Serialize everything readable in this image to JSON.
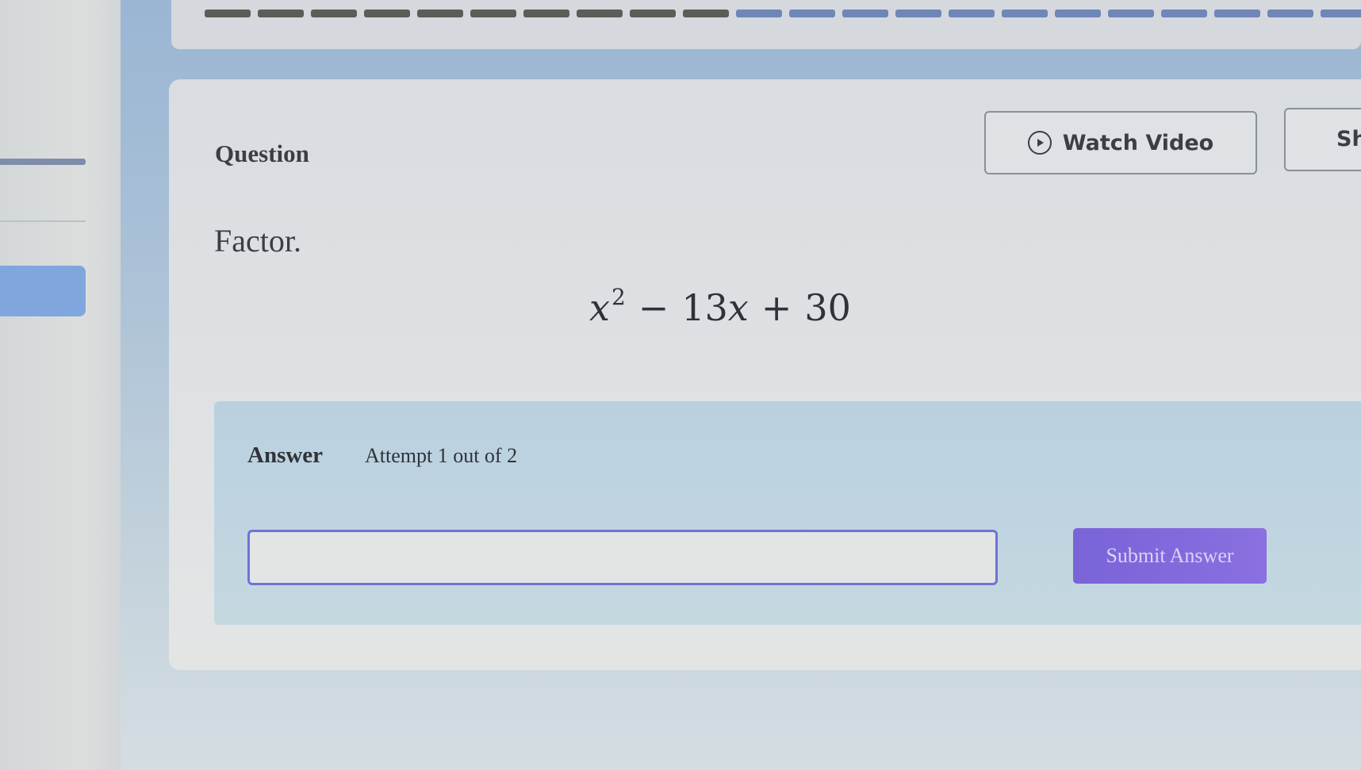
{
  "progress": {
    "segments_total": 22,
    "segments_done": 10
  },
  "question": {
    "label": "Question",
    "watch_video_label": "Watch Video",
    "show_example_label": "Sh",
    "instruction": "Factor.",
    "expression": {
      "var": "x",
      "exponent": "2",
      "op1": "−",
      "term2_coef": "13",
      "term2_var": "x",
      "op2": "+",
      "constant": "30"
    }
  },
  "answer": {
    "label": "Answer",
    "attempt_text": "Attempt 1 out of 2",
    "input_value": "",
    "submit_label": "Submit Answer"
  },
  "colors": {
    "accent": "#7a63d8",
    "input_border": "#6d73d8",
    "nav_active": "#7fa7dd"
  }
}
